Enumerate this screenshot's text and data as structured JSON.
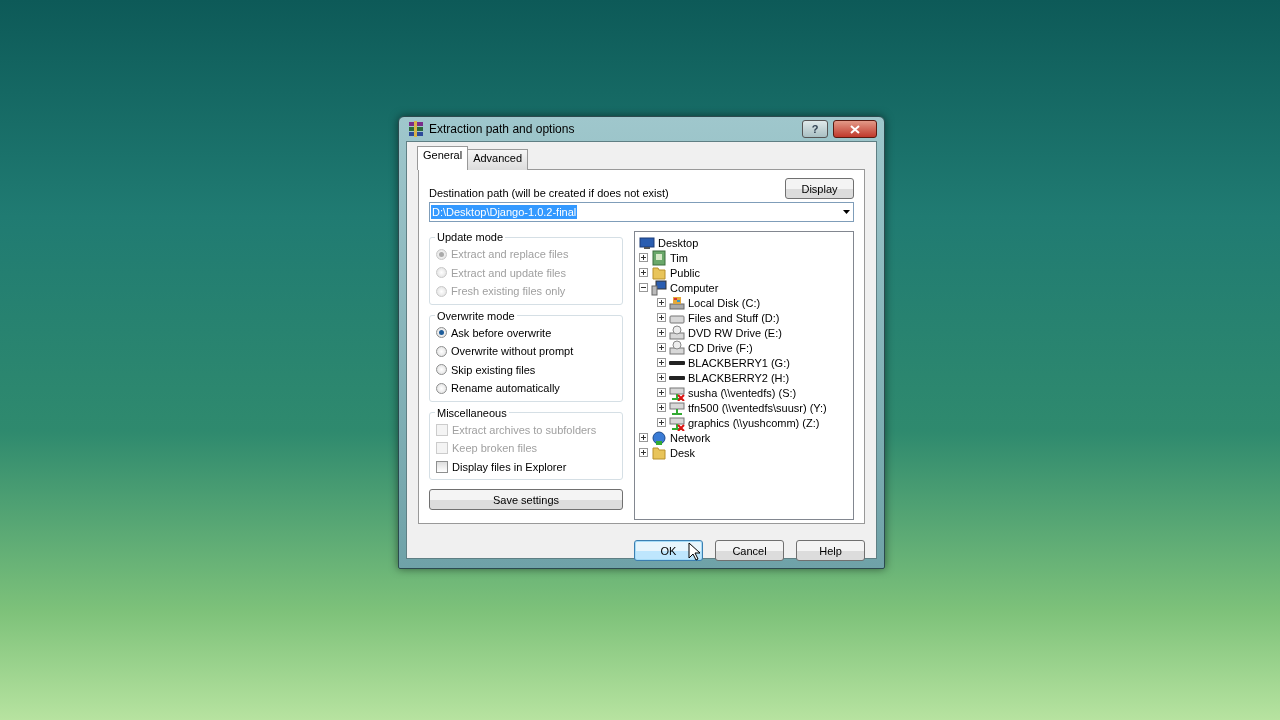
{
  "window": {
    "title": "Extraction path and options",
    "help_button": "?"
  },
  "tabs": [
    {
      "label": "General",
      "selected": true
    },
    {
      "label": "Advanced",
      "selected": false
    }
  ],
  "destination": {
    "label": "Destination path (will be created if does not exist)",
    "value": "D:\\Desktop\\Django-1.0.2-final",
    "value_selected": true,
    "display_button": "Display"
  },
  "update_mode": {
    "title": "Update mode",
    "disabled": true,
    "options": [
      {
        "label": "Extract and replace files",
        "selected": true
      },
      {
        "label": "Extract and update files",
        "selected": false
      },
      {
        "label": "Fresh existing files only",
        "selected": false
      }
    ]
  },
  "overwrite_mode": {
    "title": "Overwrite mode",
    "disabled": false,
    "options": [
      {
        "label": "Ask before overwrite",
        "selected": true
      },
      {
        "label": "Overwrite without prompt",
        "selected": false
      },
      {
        "label": "Skip existing files",
        "selected": false
      },
      {
        "label": "Rename automatically",
        "selected": false
      }
    ]
  },
  "miscellaneous": {
    "title": "Miscellaneous",
    "options": [
      {
        "label": "Extract archives to subfolders",
        "checked": false,
        "disabled": true
      },
      {
        "label": "Keep broken files",
        "checked": false,
        "disabled": true
      },
      {
        "label": "Display files in Explorer",
        "checked": false,
        "disabled": false
      }
    ]
  },
  "save_button": "Save settings",
  "tree": [
    {
      "label": "Desktop",
      "kind": "desktop",
      "expanded": true,
      "children": [
        {
          "label": "Tim",
          "kind": "user",
          "expanded": false
        },
        {
          "label": "Public",
          "kind": "folder",
          "expanded": false
        },
        {
          "label": "Computer",
          "kind": "computer",
          "expanded": true,
          "children": [
            {
              "label": "Local Disk (C:)",
              "kind": "system-disk",
              "expanded": false
            },
            {
              "label": "Files and Stuff (D:)",
              "kind": "disk",
              "expanded": false
            },
            {
              "label": "DVD RW Drive (E:)",
              "kind": "optical",
              "expanded": false
            },
            {
              "label": "CD Drive (F:)",
              "kind": "optical",
              "expanded": false
            },
            {
              "label": "BLACKBERRY1 (G:)",
              "kind": "removable",
              "expanded": false
            },
            {
              "label": "BLACKBERRY2 (H:)",
              "kind": "removable",
              "expanded": false
            },
            {
              "label": "susha (\\\\ventedfs) (S:)",
              "kind": "network-drive",
              "disconnected": true,
              "expanded": false
            },
            {
              "label": "tfn500 (\\\\ventedfs\\suusr) (Y:)",
              "kind": "network-drive",
              "disconnected": false,
              "expanded": false
            },
            {
              "label": "graphics (\\\\yushcomm) (Z:)",
              "kind": "network-drive",
              "disconnected": true,
              "expanded": false
            }
          ]
        },
        {
          "label": "Network",
          "kind": "network",
          "expanded": false
        },
        {
          "label": "Desk",
          "kind": "folder",
          "expanded": false
        }
      ]
    }
  ],
  "buttons": [
    {
      "label": "OK",
      "focused": true
    },
    {
      "label": "Cancel",
      "focused": false
    },
    {
      "label": "Help",
      "focused": false
    }
  ]
}
